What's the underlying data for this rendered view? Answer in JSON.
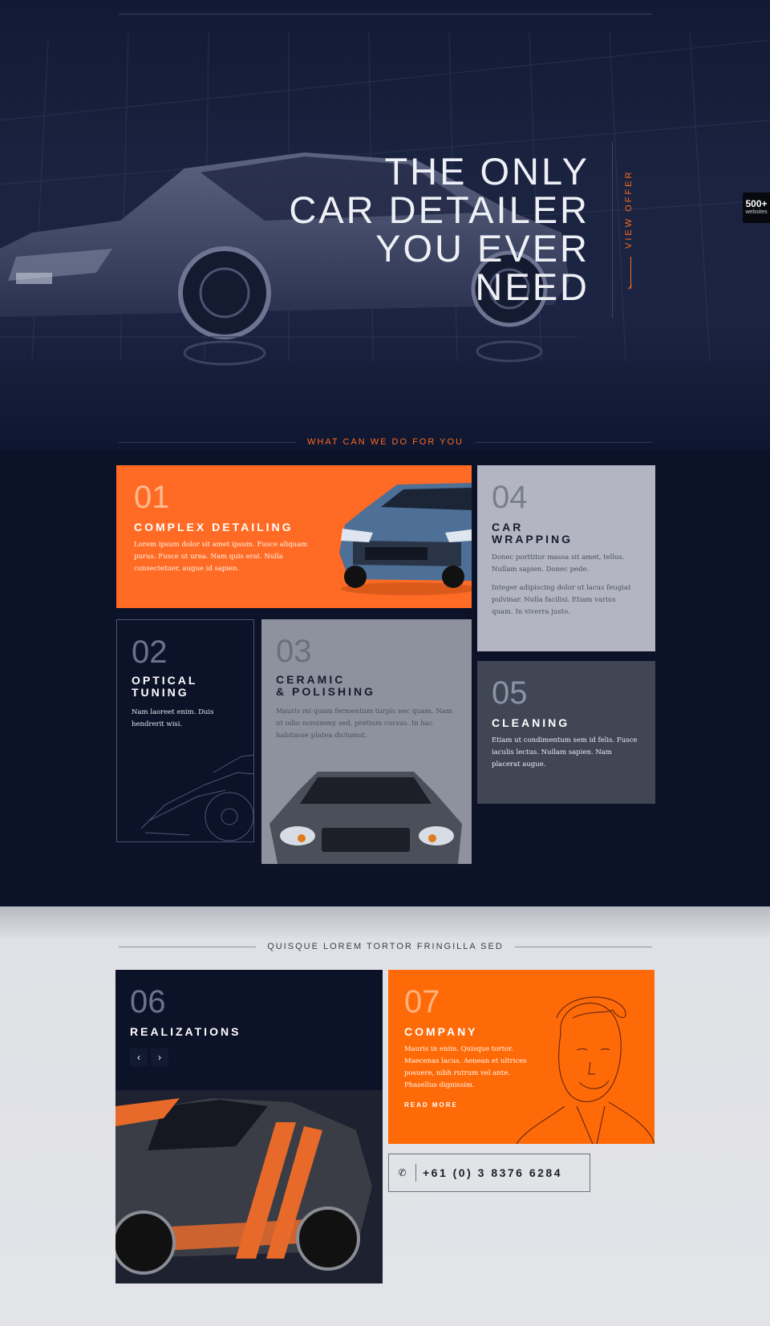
{
  "hero": {
    "title_lines": [
      "THE ONLY",
      "CAR DETAILER",
      "YOU EVER",
      "NEED"
    ],
    "view_offer": "VIEW OFFER",
    "badge_number": "500+",
    "badge_label": "websites"
  },
  "section_services": {
    "heading": "WHAT CAN WE DO FOR YOU",
    "cards": [
      {
        "number": "01",
        "title": "COMPLEX DETAILING",
        "desc": "Lorem ipsum dolor sit amet ipsum. Fusce aliquam purus. Fusce ut urna. Nam quis erat. Nulla consectetuer, augue id sapien."
      },
      {
        "number": "02",
        "title_lines": [
          "OPTICAL",
          "TUNING"
        ],
        "desc": "Nam laoreet enim. Duis hendrerit wisi."
      },
      {
        "number": "03",
        "title_lines": [
          "CERAMIC",
          "& POLISHING"
        ],
        "desc": "Mauris mi quam fermentum turpis nec quam. Nam ut odio nonummy sed, pretium cursus. In hac habitasse platea dictumst."
      },
      {
        "number": "04",
        "title_lines": [
          "CAR",
          "WRAPPING"
        ],
        "desc": "Donec porttitor massa sit amet, tellus. Nullam sapien. Donec pede.",
        "desc2": "Integer adipiscing dolor ut lacus feugiat pulvinar. Nulla facilisi. Etiam varius quam. In viverra justo."
      },
      {
        "number": "05",
        "title": "CLEANING",
        "desc": "Etiam ut condimentum sem id felis. Fusce iaculis lectus. Nullam sapien. Nam placerat augue."
      }
    ]
  },
  "section_lower": {
    "heading": "QUISQUE LOREM TORTOR FRINGILLA SED",
    "realizations": {
      "number": "06",
      "title": "REALIZATIONS",
      "prev": "‹",
      "next": "›"
    },
    "company": {
      "number": "07",
      "title": "COMPANY",
      "desc": "Mauris in enim. Quisque tortor. Maecenas lacus. Aenean et ultrices posuere, nibh rutrum vel ante. Phasellus dignissim.",
      "read_more": "READ MORE"
    },
    "phone": {
      "icon": "phone-icon",
      "number": "+61 (0) 3 8376 6284"
    }
  },
  "colors": {
    "accent": "#ff6a1f",
    "navy": "#0c1227",
    "card_grey": "#b3b6c2",
    "card_dark": "#414655"
  }
}
